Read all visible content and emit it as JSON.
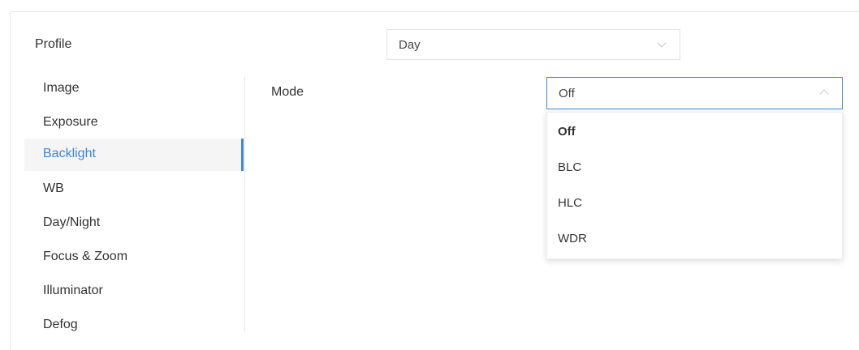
{
  "profile": {
    "label": "Profile",
    "selected": "Day",
    "icon": "chevron-down-icon"
  },
  "sidebar": {
    "items": [
      {
        "label": "Image"
      },
      {
        "label": "Exposure"
      },
      {
        "label": "Backlight",
        "active": true
      },
      {
        "label": "WB"
      },
      {
        "label": "Day/Night"
      },
      {
        "label": "Focus & Zoom"
      },
      {
        "label": "Illuminator"
      },
      {
        "label": "Defog"
      }
    ],
    "active_color": "#3d86d6"
  },
  "main": {
    "mode": {
      "label": "Mode",
      "selected": "Off",
      "icon": "chevron-up-icon",
      "options": [
        {
          "label": "Off",
          "selected": true
        },
        {
          "label": "BLC"
        },
        {
          "label": "HLC"
        },
        {
          "label": "WDR"
        }
      ]
    }
  }
}
